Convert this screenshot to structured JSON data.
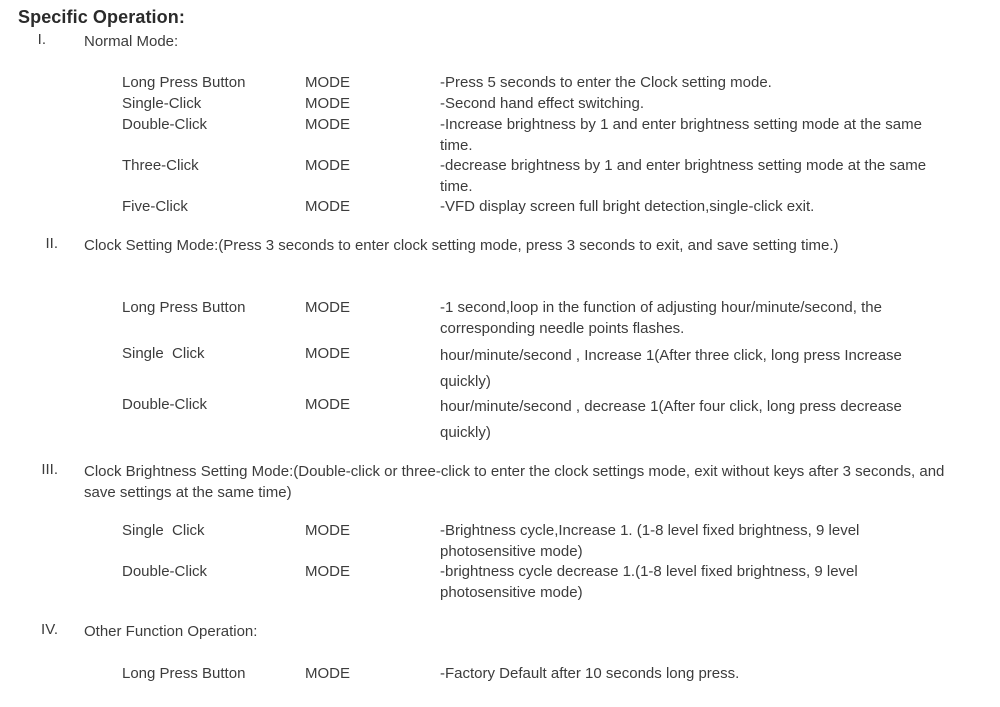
{
  "document": {
    "title": "Specific Operation:"
  },
  "sections": [
    {
      "numeral": "I.",
      "title": "Normal Mode:",
      "rows": [
        {
          "action": "Long Press Button",
          "mode": "MODE",
          "description": "-Press 5 seconds to enter the Clock setting mode."
        },
        {
          "action": "Single-Click",
          "mode": "MODE",
          "description": "-Second hand effect switching."
        },
        {
          "action": "Double-Click",
          "mode": "MODE",
          "description": "-Increase brightness  by 1 and enter brightness setting mode at the same time."
        },
        {
          "action": "Three-Click",
          "mode": "MODE",
          "description": "-decrease brightness by 1 and enter brightness setting mode at the same time."
        },
        {
          "action": "Five-Click",
          "mode": "MODE",
          "description": "-VFD display screen full bright detection,single-click exit."
        }
      ]
    },
    {
      "numeral": "II.",
      "title": "Clock Setting Mode:(Press 3 seconds to enter clock setting mode, press 3 seconds to exit, and save setting time.)",
      "rows": [
        {
          "action": "Long Press Button",
          "mode": "MODE",
          "description": "-1 second,loop  in the function of adjusting hour/minute/second, the corresponding needle points flashes."
        },
        {
          "action": "Single  Click",
          "mode": "MODE",
          "description": "hour/minute/second , Increase 1(After three click, long press Increase  quickly)"
        },
        {
          "action": "Double-Click",
          "mode": "MODE",
          "description": "hour/minute/second , decrease 1(After four  click, long press decrease quickly)"
        }
      ]
    },
    {
      "numeral": "III.",
      "title": "Clock Brightness Setting Mode:(Double-click or three-click to enter the clock settings mode, exit without keys after 3 seconds, and save settings at the same time)",
      "rows": [
        {
          "action": "Single  Click",
          "mode": "MODE",
          "description": "-Brightness cycle,Increase 1. (1-8 level fixed brightness, 9 level photosensitive mode)"
        },
        {
          "action": "Double-Click",
          "mode": "MODE",
          "description": "-brightness cycle decrease 1.(1-8 level fixed brightness, 9 level photosensitive mode)"
        }
      ]
    },
    {
      "numeral": "IV.",
      "title": "Other Function Operation:",
      "rows": [
        {
          "action": "Long Press Button",
          "mode": "MODE",
          "description": "-Factory Default  after 10 seconds long press."
        }
      ]
    }
  ]
}
